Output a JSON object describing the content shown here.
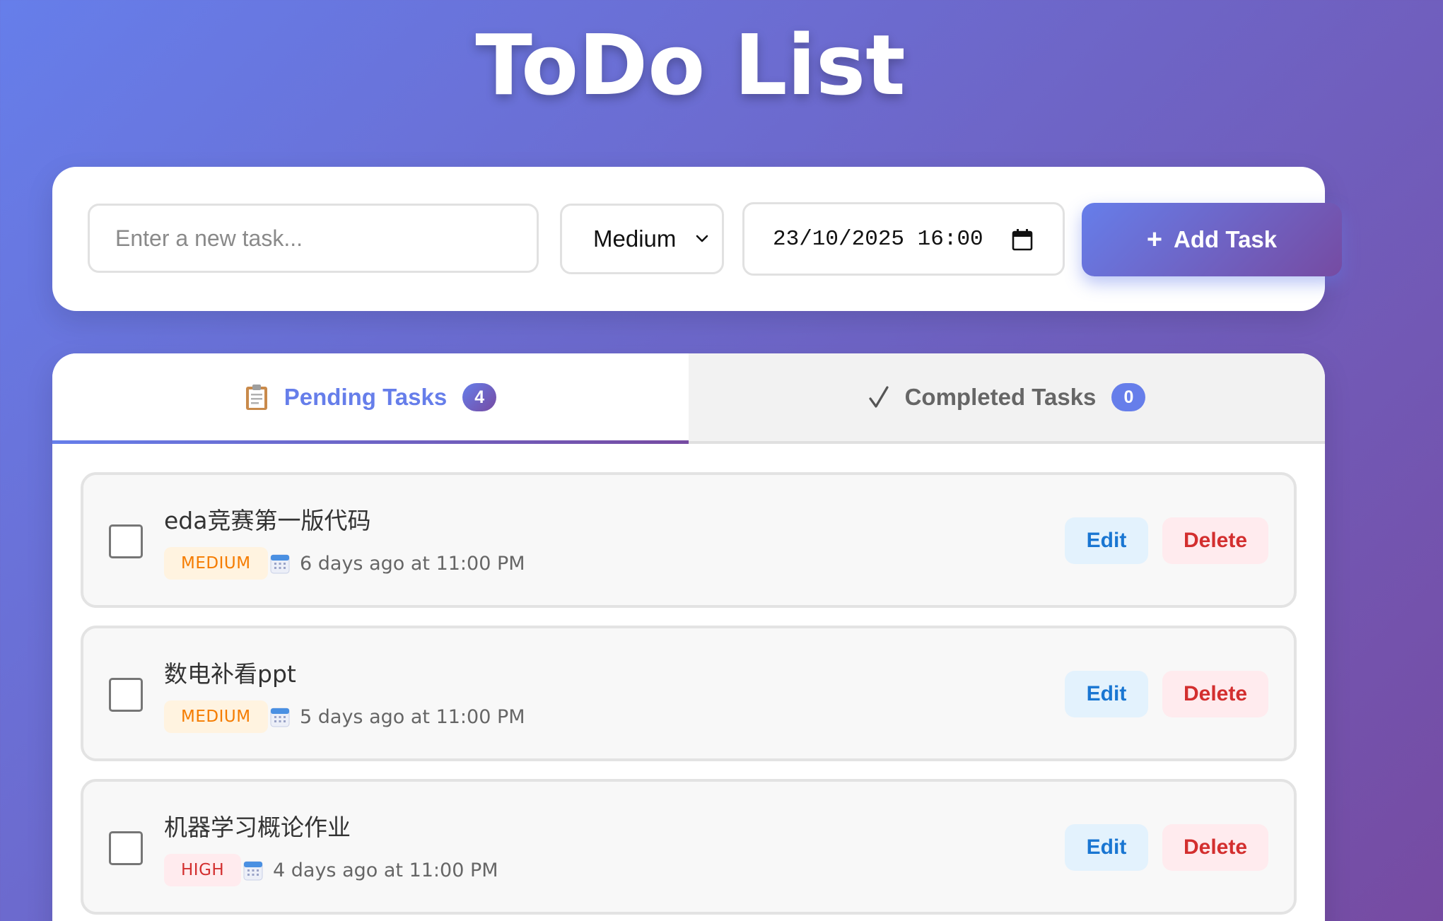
{
  "app": {
    "title": "ToDo List"
  },
  "form": {
    "task_placeholder": "Enter a new task...",
    "task_value": "",
    "priority_selected": "Medium",
    "due_value": "23/10/2025 16:00",
    "add_label": "Add Task",
    "add_icon": "+"
  },
  "tabs": [
    {
      "label": "Pending Tasks",
      "count": "4",
      "icon": "clipboard-icon",
      "active": true
    },
    {
      "label": "Completed Tasks",
      "count": "0",
      "icon": "checkmark-icon",
      "active": false
    }
  ],
  "tasks": [
    {
      "title": "eda竞赛第一版代码",
      "priority": "MEDIUM",
      "due": "6 days ago at 11:00 PM",
      "edit_label": "Edit",
      "delete_label": "Delete",
      "checked": false
    },
    {
      "title": "数电补看ppt",
      "priority": "MEDIUM",
      "due": "5 days ago at 11:00 PM",
      "edit_label": "Edit",
      "delete_label": "Delete",
      "checked": false
    },
    {
      "title": "机器学习概论作业",
      "priority": "HIGH",
      "due": "4 days ago at 11:00 PM",
      "edit_label": "Edit",
      "delete_label": "Delete",
      "checked": false
    }
  ],
  "colors": {
    "gradient_start": "#667eea",
    "gradient_end": "#764ba2",
    "medium_priority": "#f57c00",
    "high_priority": "#d32f2f",
    "edit": "#1976d2",
    "delete": "#d32f2f"
  }
}
